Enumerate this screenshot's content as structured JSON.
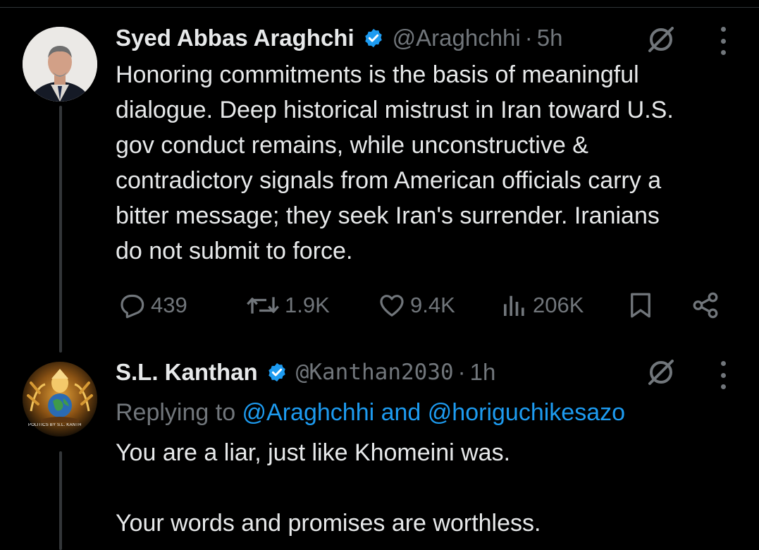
{
  "tweets": [
    {
      "author": "Syed Abbas Araghchi",
      "handle": "@Araghchhi",
      "separator": "·",
      "time": "5h",
      "text_lines": [
        "Honoring commitments is the basis of meaningful",
        "dialogue. Deep historical mistrust in Iran toward U.S.",
        "gov conduct remains, while unconstructive &",
        "contradictory signals from American officials carry a",
        "bitter message; they seek Iran's surrender. Iranians",
        "do not submit to force."
      ],
      "stats": {
        "replies": "439",
        "reposts": "1.9K",
        "likes": "9.4K",
        "views": "206K"
      }
    },
    {
      "author": "S.L. Kanthan",
      "handle": "@Kanthan2030",
      "separator": "·",
      "time": "1h",
      "reply_prefix": "Replying to ",
      "reply_user1": "@Araghchhi",
      "reply_and": " and ",
      "reply_user2": "@horiguchikesazo",
      "avatar_caption": "POLITICS BY S.L. KANTH",
      "text_lines": [
        "You are a liar, just like Khomeini was.",
        "",
        "Your words and promises are worthless."
      ]
    }
  ],
  "icons": {
    "verified": "verified-badge-icon",
    "grok": "grok-icon",
    "more": "more-options-icon",
    "reply": "reply-icon",
    "repost": "repost-icon",
    "like": "like-icon",
    "views": "views-icon",
    "bookmark": "bookmark-icon",
    "share": "share-icon"
  },
  "colors": {
    "background": "#000000",
    "text": "#e7e9ea",
    "secondary": "#71767b",
    "accent": "#1d9bf0"
  }
}
